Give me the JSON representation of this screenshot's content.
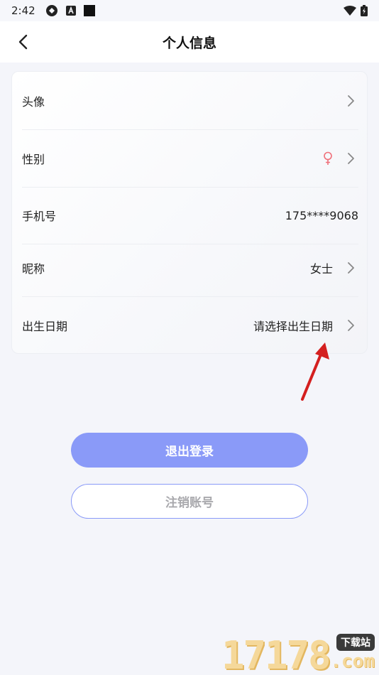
{
  "status_bar": {
    "time": "2:42",
    "left_icons": [
      "sync-icon",
      "app-a-icon",
      "square-icon"
    ],
    "right_icons": [
      "wifi-icon",
      "battery-charging-icon"
    ]
  },
  "header": {
    "title": "个人信息",
    "back_icon": "chevron-left-icon"
  },
  "profile": {
    "rows": [
      {
        "label": "头像",
        "value": "",
        "chevron": true
      },
      {
        "label": "性别",
        "value": "",
        "gender_icon": "female-icon",
        "chevron": true
      },
      {
        "label": "手机号",
        "value": "175****9068",
        "chevron": false
      },
      {
        "label": "昵称",
        "value": "女士",
        "chevron": true
      },
      {
        "label": "出生日期",
        "value": "请选择出生日期",
        "chevron": true
      }
    ]
  },
  "actions": {
    "logout_label": "退出登录",
    "cancel_account_label": "注销账号"
  },
  "watermark": {
    "digits": "17178",
    "badge": "下载站",
    "suffix": ".com"
  },
  "colors": {
    "accent": "#8a9af8",
    "female_icon": "#f0707a",
    "annotation_arrow": "#d41f1f",
    "background": "#f4f5fa"
  }
}
